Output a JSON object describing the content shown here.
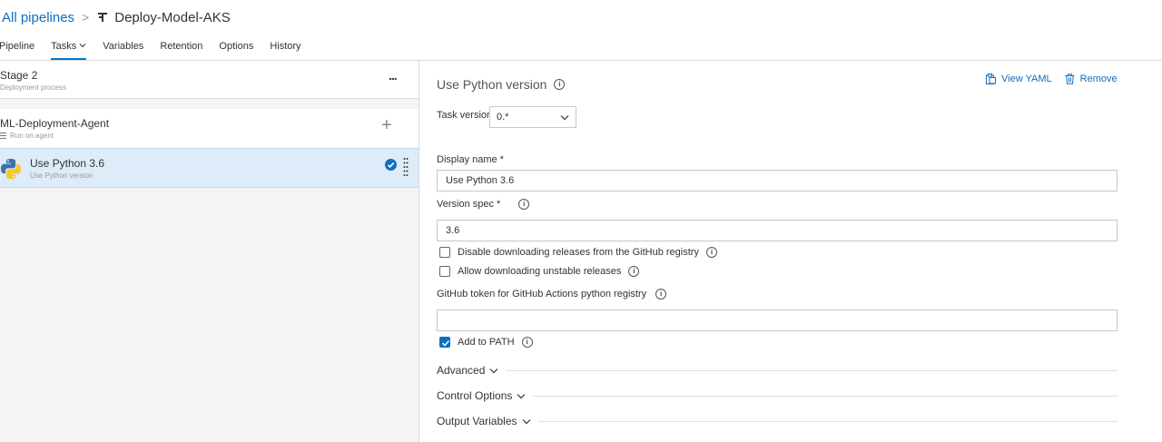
{
  "header": {
    "breadcrumb_root": "All pipelines",
    "breadcrumb_separator": ">",
    "pipeline_title": "Deploy-Model-AKS"
  },
  "tabs": [
    {
      "label": "Pipeline",
      "active": false
    },
    {
      "label": "Tasks",
      "active": true
    },
    {
      "label": "Variables",
      "active": false
    },
    {
      "label": "Retention",
      "active": false
    },
    {
      "label": "Options",
      "active": false
    },
    {
      "label": "History",
      "active": false
    }
  ],
  "left": {
    "stage": {
      "title": "Stage 2",
      "subtitle": "Deployment process",
      "more": "..."
    },
    "agent": {
      "title": "ML-Deployment-Agent",
      "subtitle": "Run on agent",
      "add": "+"
    },
    "task": {
      "title": "Use Python 3.6",
      "subtitle": "Use Python version",
      "icon": "python-icon"
    }
  },
  "right": {
    "heading": "Use Python version",
    "view_yaml": "View YAML",
    "remove": "Remove",
    "task_version_label": "Task version",
    "task_version_value": "0.*",
    "display_name_label": "Display name",
    "display_name_value": "Use Python 3.6",
    "version_spec_label": "Version spec",
    "version_spec_value": "3.6",
    "required_marker": "*",
    "disable_downloading_label": "Disable downloading releases from the GitHub registry",
    "allow_unstable_label": "Allow downloading unstable releases",
    "github_token_label": "GitHub token for GitHub Actions python registry",
    "github_token_value": "",
    "add_to_path_label": "Add to PATH",
    "add_to_path_checked": true,
    "sections": [
      "Advanced",
      "Control Options",
      "Output Variables"
    ]
  },
  "colors": {
    "accent": "#106ebe",
    "selected_row": "#deecf9"
  }
}
